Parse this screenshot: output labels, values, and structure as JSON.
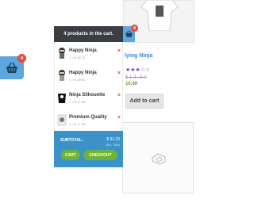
{
  "shop": {
    "product_name": "lying Ninja",
    "rating_stars": "★★★☆☆",
    "old_price": "$ 1 2 . 5 0",
    "new_price": "10.49",
    "add_to_cart_label": "Add to cart"
  },
  "floating_cart": {
    "count": "4"
  },
  "cart": {
    "header_title": "4 products in the cart.",
    "badge_count": "4",
    "items": [
      {
        "name": "Happy Ninja",
        "meta": "1 × $ 18.74",
        "remove": "×"
      },
      {
        "name": "Happy Ninja",
        "meta": "1 × $ 39.91",
        "remove": "×"
      },
      {
        "name": "Ninja Silhouette",
        "meta": "1 × $ 17.49",
        "remove": "×"
      },
      {
        "name": "Premium Quality",
        "meta": "1 × $ 17.49",
        "remove": "×"
      }
    ],
    "subtotal_label": "SUBTOTAL:",
    "subtotal_value": "$ 91.33",
    "subtotal_tax": "(EX. TAX)",
    "cart_button": "CART",
    "checkout_button": "CHECKOUT"
  },
  "colors": {
    "accent_blue": "#5ba7de",
    "footer_blue": "#3b92c9",
    "header_dark": "#3a3d42",
    "badge_red": "#e74c3c",
    "button_green": "#6db338"
  }
}
